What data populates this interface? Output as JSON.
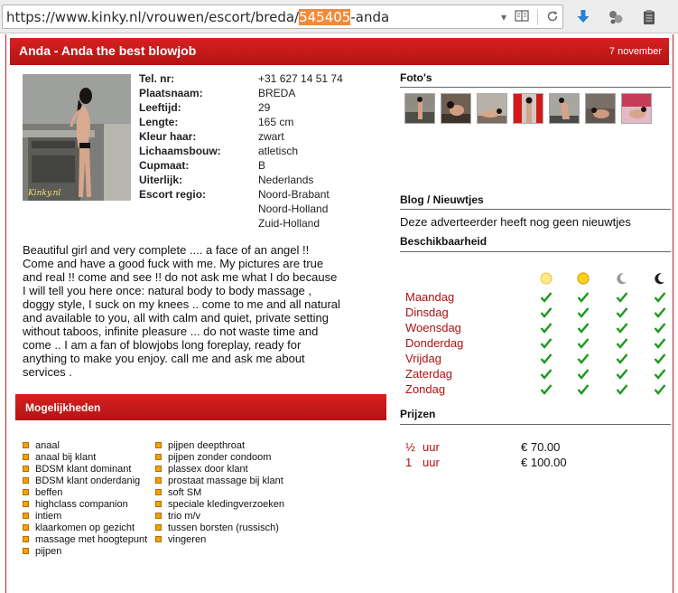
{
  "browser": {
    "url_prefix": "https://www.kinky.nl/vrouwen/escort/breda/",
    "url_highlight": "545405",
    "url_suffix": "-anda",
    "icons": [
      "dropdown-icon",
      "reader-view-icon",
      "reload-icon",
      "download-icon",
      "extensions-icon",
      "clipboard-icon"
    ]
  },
  "profile": {
    "title": "Anda - Anda the best blowjob",
    "date": "7 november",
    "specs": [
      {
        "label": "Tel. nr:",
        "value": "+31 627 14 51 74"
      },
      {
        "label": "Plaatsnaam:",
        "value": "BREDA"
      },
      {
        "label": "Leeftijd:",
        "value": "29"
      },
      {
        "label": "Lengte:",
        "value": "165 cm"
      },
      {
        "label": "Kleur haar:",
        "value": "zwart"
      },
      {
        "label": "Lichaamsbouw:",
        "value": "atletisch"
      },
      {
        "label": "Cupmaat:",
        "value": "B"
      },
      {
        "label": "Uiterlijk:",
        "value": "Nederlands"
      },
      {
        "label": "Escort regio:",
        "value": "Noord-Brabant"
      },
      {
        "label": "",
        "value": "Noord-Holland"
      },
      {
        "label": "",
        "value": "Zuid-Holland"
      }
    ],
    "photo_watermark": "Kinky.nl",
    "description": [
      "Beautiful girl and very complete .... a face of an angel !!",
      "Come and have a good fuck with me. My pictures are true",
      "and real !! come and see !! do not ask me what I do because",
      "I will tell you here once: natural body to body massage ,",
      "doggy style, I suck on my knees .. come to me and all natural",
      "and available to you, all with calm and quiet, private setting",
      "without taboos, infinite pleasure ... do not waste time and",
      "come .. I am a fan of blowjobs long foreplay, ready for",
      "anything to make you enjoy. call me and ask me about",
      "services ."
    ]
  },
  "mogelijkheden": {
    "heading": "Mogelijkheden",
    "col1": [
      "anaal",
      "anaal bij klant",
      "BDSM klant dominant",
      "BDSM klant onderdanig",
      "beffen",
      "highclass companion",
      "intiem",
      "klaarkomen op gezicht",
      "massage met hoogtepunt",
      "pijpen"
    ],
    "col2": [
      "pijpen deepthroat",
      "pijpen zonder condoom",
      "plassex door klant",
      "prostaat massage bij klant",
      "soft SM",
      "speciale kledingverzoeken",
      "trio m/v",
      "tussen borsten (russisch)",
      "vingeren"
    ]
  },
  "sidebar": {
    "photos_heading": "Foto's",
    "blog_heading": "Blog / Nieuwtjes",
    "blog_text": "Deze adverteerder heeft nog geen nieuwtjes",
    "availability_heading": "Beschikbaarheid",
    "day_parts": [
      "morning-sun-icon",
      "afternoon-sun-icon",
      "evening-moon-icon",
      "night-moon-icon"
    ],
    "days": [
      "Maandag",
      "Dinsdag",
      "Woensdag",
      "Donderdag",
      "Vrijdag",
      "Zaterdag",
      "Zondag"
    ],
    "prices_heading": "Prijzen",
    "prices": [
      {
        "qty": "½",
        "unit": "uur",
        "amount": "€ 70.00"
      },
      {
        "qty": "1",
        "unit": "uur",
        "amount": "€ 100.00"
      }
    ]
  },
  "colors": {
    "accent": "#c41818",
    "day_text": "#b01010",
    "check": "#1a9a1a",
    "option_bullet": "#f3a200"
  }
}
